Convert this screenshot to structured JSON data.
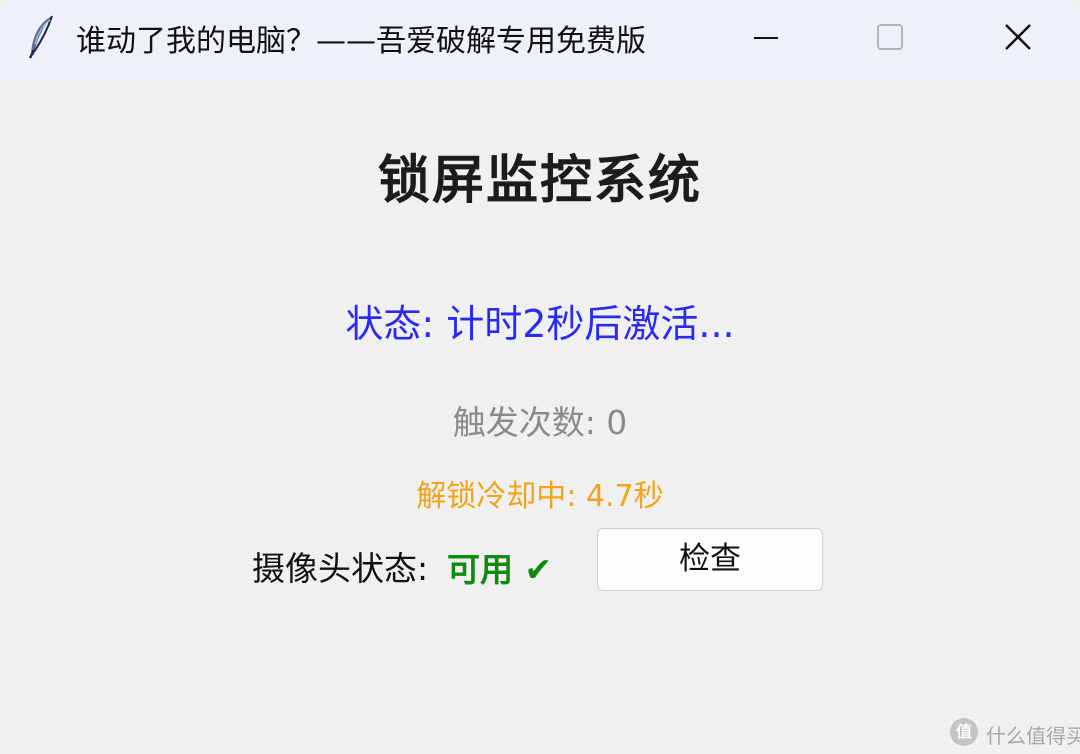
{
  "window": {
    "title": "谁动了我的电脑？——吾爱破解专用免费版",
    "icon": "feather-icon",
    "controls": {
      "minimize": "minimize-icon",
      "maximize": "maximize-icon",
      "close": "close-icon"
    }
  },
  "main": {
    "heading": "锁屏监控系统",
    "status": "状态: 计时2秒后激活...",
    "trigger_count": "触发次数: 0",
    "cooldown": "解锁冷却中: 4.7秒",
    "camera": {
      "label": "摄像头状态:",
      "value": "可用 ✔",
      "check_button_label": "检查"
    }
  },
  "watermark": {
    "badge": "值",
    "text": "什么值得买"
  },
  "colors": {
    "status": "#2a2af2",
    "trigger": "#8a8a8a",
    "cooldown": "#f3a31a",
    "camera_ok": "#118a11",
    "titlebar": "#eef2f8",
    "window_bg": "#f0f0f0"
  }
}
